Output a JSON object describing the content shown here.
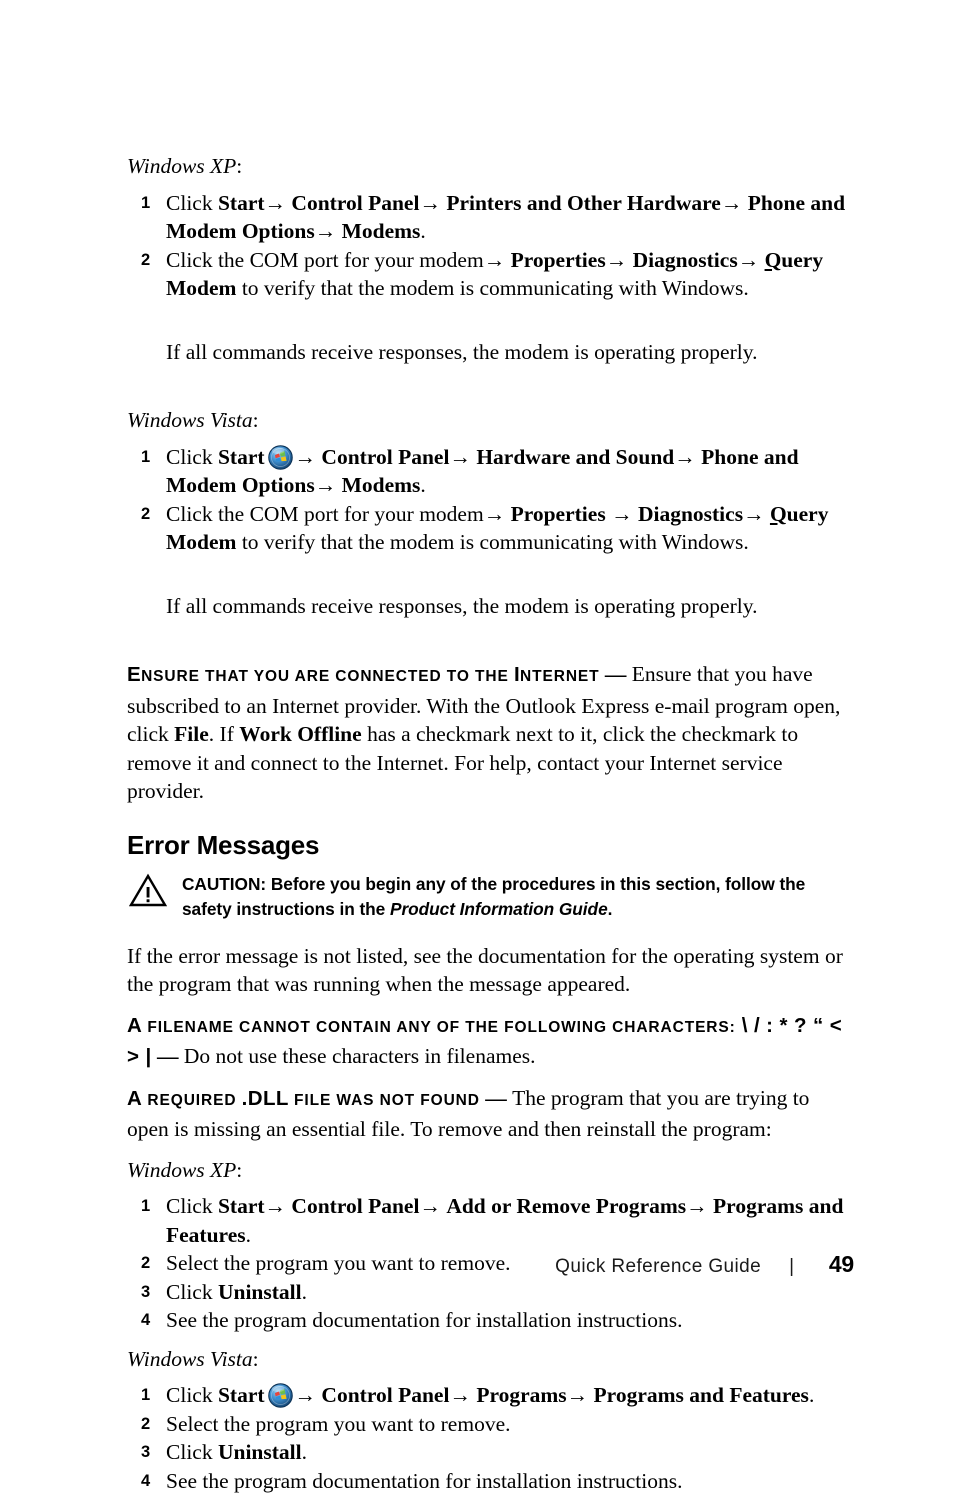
{
  "document": {
    "footer_title": "Quick Reference Guide",
    "footer_separator": "|",
    "page_number": "49"
  },
  "modem_section": {
    "xp_label": "Windows XP",
    "xp_label_colon": ":",
    "xp_steps": [
      {
        "num": "1",
        "prefix": "Click ",
        "bold_start": "Start",
        "arrow1": "→ ",
        "bold_1": "Control Panel",
        "arrow2": "→ ",
        "bold_2": "Printers and Other Hardware",
        "arrow3": "→ ",
        "bold_3": "Phone and Modem Options",
        "arrow4": "→ ",
        "bold_4": "Modems",
        "tail": "."
      },
      {
        "num": "2",
        "prefix": "Click the COM port for your modem",
        "arrow1": "→ ",
        "bold_1": "Properties",
        "arrow2": "→ ",
        "bold_2": "Diagnostics",
        "arrow3": "→ ",
        "bold_q": "Q",
        "bold_3": "uery Modem",
        "tail": " to verify that the modem is communicating with Windows."
      }
    ],
    "xp_note": "If all commands receive responses, the modem is operating properly.",
    "vista_label": "Windows Vista",
    "vista_label_colon": ":",
    "vista_steps": [
      {
        "num": "1",
        "prefix": "Click ",
        "bold_start": "Start",
        "icon": "windows-start-orb-icon",
        "arrow1": "→ ",
        "bold_1": "Control Panel",
        "arrow2": "→ ",
        "bold_2": "Hardware and Sound",
        "arrow3": "→ ",
        "bold_3": "Phone and Modem Options",
        "arrow4": "→ ",
        "bold_4": "Modems",
        "tail": "."
      },
      {
        "num": "2",
        "prefix": "Click the COM port for your modem",
        "arrow1": "→ ",
        "bold_1": "Properties",
        "arrow2": " → ",
        "bold_2": "Diagnostics",
        "arrow3": "→ ",
        "bold_q": "Q",
        "bold_3": "uery Modem",
        "tail": " to verify that the modem is communicating with Windows."
      }
    ],
    "vista_note": "If all commands receive responses, the modem is operating properly."
  },
  "internet_check": {
    "heading_first_letter": "E",
    "heading_rest": "NSURE THAT YOU ARE CONNECTED TO THE ",
    "heading_second_cap": "I",
    "heading_tail": "NTERNET",
    "dash": " — ",
    "body_1": "Ensure that you have subscribed to an Internet provider. With the Outlook Express e-mail program open, click ",
    "bold_file": "File",
    "body_2": ". If ",
    "bold_work_offline": "Work Offline",
    "body_3": " has a checkmark next to it, click the checkmark to remove it and connect to the Internet. For help, contact your Internet service provider."
  },
  "error_messages": {
    "heading": "Error Messages",
    "caution": {
      "icon": "warning-triangle-icon",
      "label": "CAUTION:",
      "text_1": " Before you begin any of the procedures in this section, follow the safety instructions in the ",
      "italic_ref": "Product Information Guide",
      "text_2": "."
    },
    "intro": "If the error message is not listed, see the documentation for the operating system or the program that was running when the message appeared.",
    "entries": [
      {
        "heading_first_letter": "A",
        "heading_rest": " FILENAME CANNOT CONTAIN ANY OF THE FOLLOWING CHARACTERS:",
        "heading_chars": " \\ / : * ? “ < > |",
        "dash": " — ",
        "body": "Do not use these characters in filenames."
      },
      {
        "heading_first_letter": "A",
        "heading_rest": " REQUIRED ",
        "heading_emph": ".DLL",
        "heading_rest2": " FILE WAS NOT FOUND",
        "dash": " — ",
        "body": "The program that you are trying to open is missing an essential file. To remove and then reinstall the program:"
      }
    ],
    "xp_label": "Windows XP",
    "xp_label_colon": ":",
    "xp_steps": [
      {
        "num": "1",
        "prefix": "Click ",
        "bold_start": "Start",
        "arrow1": "→ ",
        "bold_1": "Control Panel",
        "arrow2": "→ ",
        "bold_2": "Add or Remove Programs",
        "arrow3": "→ ",
        "bold_3": "Programs and Features",
        "tail": "."
      },
      {
        "num": "2",
        "plain": "Select the program you want to remove."
      },
      {
        "num": "3",
        "prefix": "Click ",
        "bold_1": "Uninstall",
        "tail": "."
      },
      {
        "num": "4",
        "plain": "See the program documentation for installation instructions."
      }
    ],
    "vista_label": "Windows Vista",
    "vista_label_colon": ":",
    "vista_steps": [
      {
        "num": "1",
        "prefix": "Click ",
        "bold_start": "Start",
        "icon": "windows-start-orb-icon",
        "arrow1": "→ ",
        "bold_1": "Control Panel",
        "arrow2": "→ ",
        "bold_2": "Programs",
        "arrow3": "→ ",
        "bold_3": "Programs and Features",
        "tail": "."
      },
      {
        "num": "2",
        "plain": "Select the program you want to remove."
      },
      {
        "num": "3",
        "prefix": "Click ",
        "bold_1": "Uninstall",
        "tail": "."
      },
      {
        "num": "4",
        "plain": "See the program documentation for installation instructions."
      }
    ]
  },
  "colors": {
    "text": "#000000",
    "orb_blue_outer": "#1d5f9e",
    "orb_blue_inner": "#6fb4e8",
    "flag_red": "#e8443a",
    "flag_green": "#6cc04a",
    "flag_blue": "#2f8fd8",
    "flag_yellow": "#f5c518"
  }
}
